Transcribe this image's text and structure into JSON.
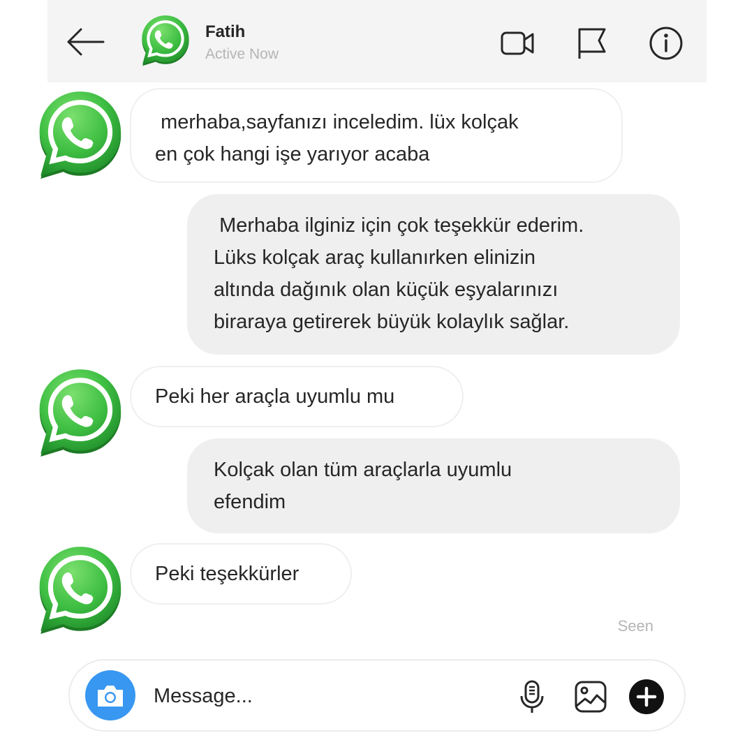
{
  "header": {
    "contact_name": "Fatih",
    "status": "Active Now",
    "icons": [
      "back-arrow-icon",
      "whatsapp-icon",
      "video-camera-icon",
      "flag-icon",
      "info-icon"
    ]
  },
  "messages": [
    {
      "direction": "incoming",
      "text": " merhaba,sayfanızı inceledim. lüx kolçak\nen çok hangi işe yarıyor acaba"
    },
    {
      "direction": "outgoing",
      "text": " Merhaba ilginiz için çok teşekkür ederim.\nLüks kolçak araç kullanırken elinizin\naltında dağınık olan küçük eşyalarınızı\nbiraraya getirerek büyük kolaylık sağlar."
    },
    {
      "direction": "incoming",
      "text": "Peki her araçla uyumlu mu"
    },
    {
      "direction": "outgoing",
      "text": "Kolçak olan tüm araçlarla uyumlu\nefendim"
    },
    {
      "direction": "incoming",
      "text": "Peki teşekkürler"
    }
  ],
  "seen_label": "Seen",
  "composer": {
    "placeholder": "Message...",
    "icons": [
      "camera-icon",
      "microphone-icon",
      "gallery-icon",
      "plus-icon"
    ]
  },
  "colors": {
    "header_bg": "#f4f4f4",
    "outgoing_bubble": "#efefef",
    "incoming_border": "#efefef",
    "camera_blue": "#3897f0",
    "whatsapp_green": "#3fc84a",
    "muted_text": "#b5b5b5"
  }
}
